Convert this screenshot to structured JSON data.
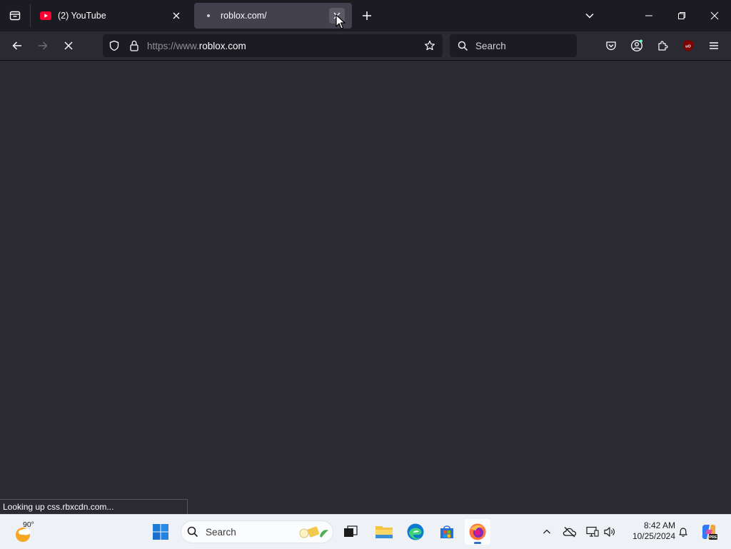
{
  "tabs": [
    {
      "label": "(2) YouTube",
      "active": false
    },
    {
      "label": "roblox.com/",
      "active": true
    }
  ],
  "nav": {
    "url_prefix": "https://www.",
    "url_host": "roblox.com"
  },
  "search": {
    "placeholder": "Search"
  },
  "status": {
    "text": "Looking up css.rbxcdn.com..."
  },
  "taskbar": {
    "weather_temp": "90°",
    "search_placeholder": "Search",
    "clock_time": "8:42 AM",
    "clock_date": "10/25/2024"
  },
  "colors": {
    "tabstrip_bg": "#1c1b22",
    "toolbar_bg": "#2b2a33",
    "content_bg": "#2b2a33",
    "active_tab_bg": "#42414d",
    "taskbar_bg": "#eef1f6",
    "youtube_red": "#ff0033"
  },
  "icons": {
    "tab_list": "tab-list-icon",
    "youtube": "youtube-favicon",
    "new_tab": "plus-icon",
    "all_tabs": "chevron-down-icon",
    "back": "back-arrow-icon",
    "forward": "forward-arrow-icon",
    "stop": "stop-icon",
    "shield": "tracking-shield-icon",
    "lock": "lock-icon",
    "bookmark": "star-icon",
    "pocket": "pocket-icon",
    "account": "account-icon",
    "extensions": "extensions-icon",
    "ublock": "ublock-origin-icon",
    "menu": "hamburger-menu-icon"
  }
}
